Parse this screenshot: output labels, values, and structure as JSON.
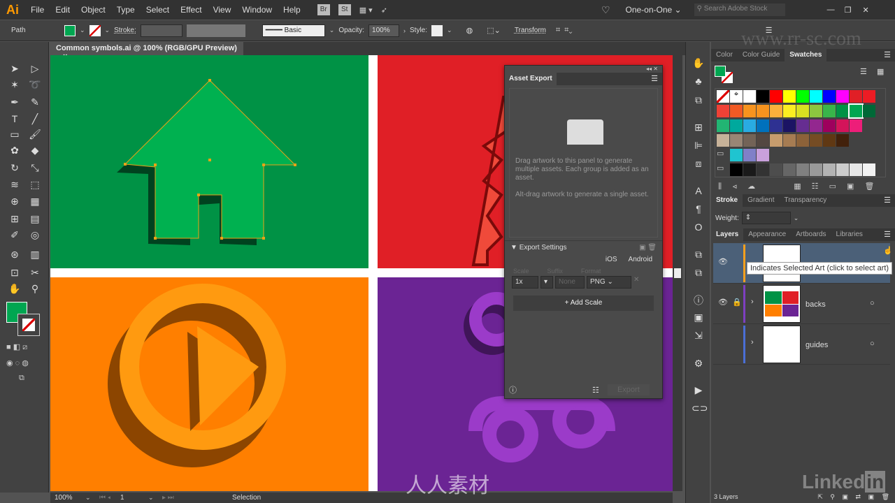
{
  "app": {
    "logo": "Ai",
    "menus": [
      "File",
      "Edit",
      "Object",
      "Type",
      "Select",
      "Effect",
      "View",
      "Window",
      "Help"
    ],
    "bridge": "Br",
    "stock": "St",
    "workspace": "One-on-One",
    "search_placeholder": "Search Adobe Stock"
  },
  "control": {
    "selection_type": "Path",
    "fill_color": "#00a651",
    "stroke_label": "Stroke:",
    "brush": "Basic",
    "opacity_label": "Opacity:",
    "opacity": "100%",
    "style_label": "Style:",
    "transform": "Transform"
  },
  "document": {
    "tab_title": "Common symbols.ai @ 100% (RGB/GPU Preview)",
    "close": "×"
  },
  "artboards": {
    "colors": [
      "#009245",
      "#e01f26",
      "#ff7f00",
      "#6b2494"
    ]
  },
  "status": {
    "zoom": "100%",
    "artboard": "1",
    "tool": "Selection"
  },
  "asset_export": {
    "title": "Asset Export",
    "hint1": "Drag artwork to this panel to generate multiple assets. Each group is added as an asset.",
    "hint2": "Alt-drag artwork to generate a single asset.",
    "export_settings": "Export Settings",
    "ios": "iOS",
    "android": "Android",
    "scale_label": "Scale",
    "suffix_label": "Suffix",
    "format_label": "Format",
    "scale": "1x",
    "suffix_placeholder": "None",
    "format": "PNG",
    "add_scale": "Add Scale",
    "export": "Export"
  },
  "color_panel": {
    "tabs": [
      "Color",
      "Color Guide",
      "Swatches"
    ],
    "active": "Swatches",
    "swatch_rows": [
      [
        "none",
        "registration",
        "#ffffff",
        "#000000",
        "#ff0000",
        "#ffff00",
        "#00ff00",
        "#00ffff",
        "#0000ff",
        "#ff00ff",
        "#e01f26",
        "#ed1c24"
      ],
      [
        "#ef4136",
        "#f15a24",
        "#f7931e",
        "#f7931e",
        "#fbb03b",
        "#fcee21",
        "#d9e021",
        "#8cc63f",
        "#39b54a",
        "#009245",
        "#00a651",
        "#006837"
      ],
      [
        "#22b573",
        "#00a99d",
        "#29abe2",
        "#0071bc",
        "#2e3192",
        "#1b1464",
        "#662d91",
        "#93278f",
        "#9e005d",
        "#d4145a",
        "#ed1e79"
      ],
      [
        "#c7b299",
        "#998675",
        "#736357",
        "#534741",
        "#c69c6d",
        "#a67c52",
        "#8c6239",
        "#754c24",
        "#603813",
        "#42210b"
      ],
      [
        "folder",
        "#1fc4d0",
        "#8080c8",
        "#c9a0dc"
      ],
      [
        "folder",
        "#000000",
        "#1a1a1a",
        "#333333",
        "#4d4d4d",
        "#666666",
        "#808080",
        "#999999",
        "#b3b3b3",
        "#cccccc",
        "#e6e6e6",
        "#f2f2f2"
      ]
    ]
  },
  "stroke_panel": {
    "tabs": [
      "Stroke",
      "Gradient",
      "Transparency"
    ],
    "weight_label": "Weight:"
  },
  "layers_panel": {
    "tabs": [
      "Layers",
      "Appearance",
      "Artboards",
      "Libraries"
    ],
    "layers": [
      {
        "name": "",
        "color": "#f7a01e"
      },
      {
        "name": "backs",
        "color": "#7e3fc1"
      },
      {
        "name": "guides",
        "color": "#4a6fd6"
      }
    ],
    "tooltip": "Indicates Selected Art (click to select art)",
    "count": "3 Layers"
  },
  "watermarks": {
    "site": "www.rr-sc.com",
    "brand": "人人素材",
    "linkedin": "Linked"
  }
}
